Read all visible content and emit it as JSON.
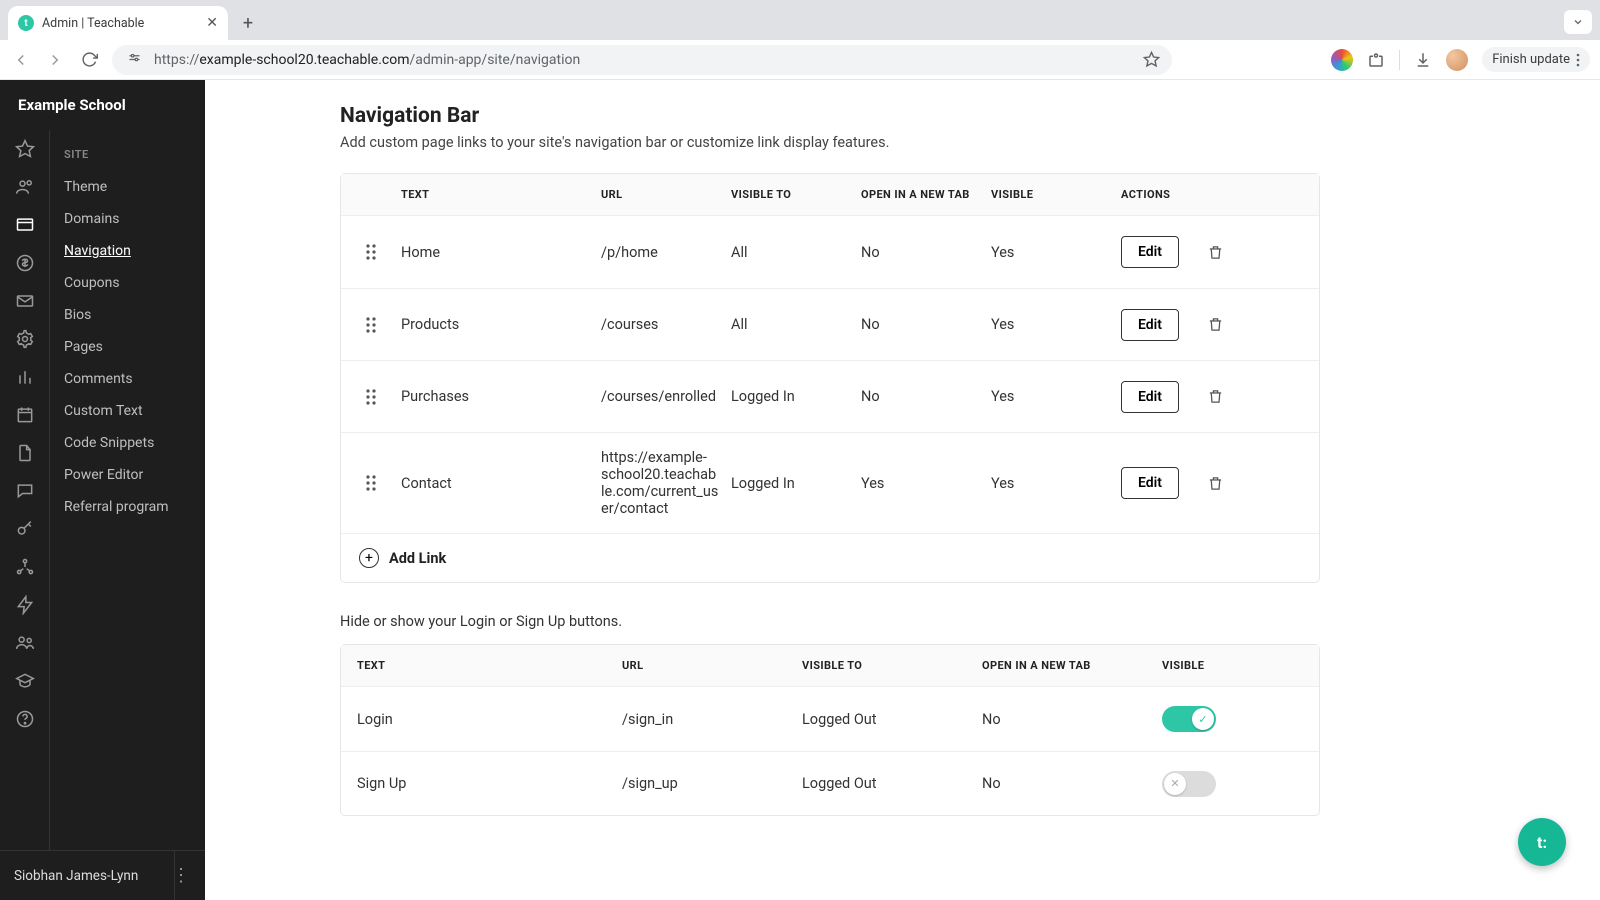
{
  "browser": {
    "tab_title": "Admin | Teachable",
    "url_prefix": "https://",
    "url_host": "example-school20.teachable.com",
    "url_path": "/admin-app/site/navigation",
    "finish_update": "Finish update"
  },
  "sidebar": {
    "school_name": "Example School",
    "section_label": "SITE",
    "links": {
      "theme": "Theme",
      "domains": "Domains",
      "navigation": "Navigation",
      "coupons": "Coupons",
      "bios": "Bios",
      "pages": "Pages",
      "comments": "Comments",
      "custom_text": "Custom Text",
      "code_snippets": "Code Snippets",
      "power_editor": "Power Editor",
      "referral": "Referral program"
    },
    "footer_user": "Siobhan James-Lynn"
  },
  "page": {
    "title": "Navigation Bar",
    "subtitle": "Add custom page links to your site's navigation bar or customize link display features.",
    "login_note": "Hide or show your Login or Sign Up buttons."
  },
  "table_headers": {
    "text": "TEXT",
    "url": "URL",
    "visible_to": "VISIBLE TO",
    "new_tab": "OPEN IN A NEW TAB",
    "visible": "VISIBLE",
    "actions": "ACTIONS"
  },
  "nav_links": [
    {
      "text": "Home",
      "url": "/p/home",
      "visible_to": "All",
      "new_tab": "No",
      "visible": "Yes"
    },
    {
      "text": "Products",
      "url": "/courses",
      "visible_to": "All",
      "new_tab": "No",
      "visible": "Yes"
    },
    {
      "text": "Purchases",
      "url": "/courses/enrolled",
      "visible_to": "Logged In",
      "new_tab": "No",
      "visible": "Yes"
    },
    {
      "text": "Contact",
      "url": "https://example-school20.teachable.com/current_user/contact",
      "visible_to": "Logged In",
      "new_tab": "Yes",
      "visible": "Yes"
    }
  ],
  "edit_label": "Edit",
  "add_link_label": "Add Link",
  "auth_links": [
    {
      "text": "Login",
      "url": "/sign_in",
      "visible_to": "Logged Out",
      "new_tab": "No",
      "visible": true
    },
    {
      "text": "Sign Up",
      "url": "/sign_up",
      "visible_to": "Logged Out",
      "new_tab": "No",
      "visible": false
    }
  ],
  "fab_label": "t:"
}
